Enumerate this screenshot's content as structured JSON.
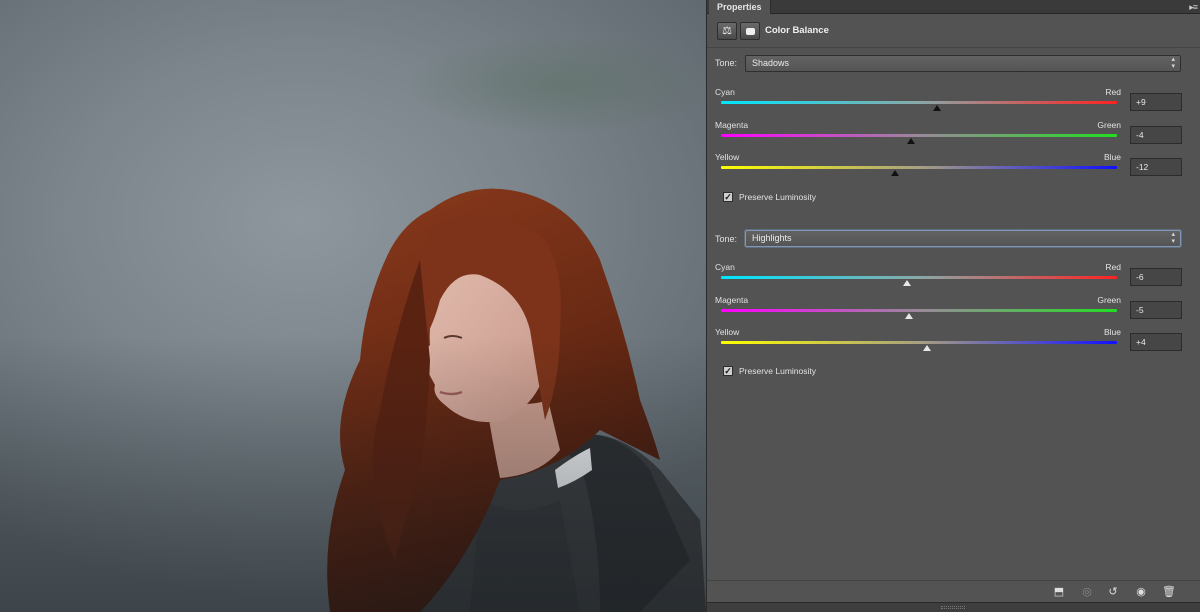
{
  "panel": {
    "tab_label": "Properties",
    "menu_icon": "panel-menu-icon",
    "adjustment_title": "Color Balance",
    "header_icons": [
      "color-balance-icon",
      "layer-mask-icon"
    ]
  },
  "shadows": {
    "tone_label": "Tone:",
    "tone_value": "Shadows",
    "sliders": [
      {
        "left": "Cyan",
        "right": "Red",
        "value": "+9",
        "level": 9
      },
      {
        "left": "Magenta",
        "right": "Green",
        "value": "-4",
        "level": -4
      },
      {
        "left": "Yellow",
        "right": "Blue",
        "value": "-12",
        "level": -12
      }
    ],
    "preserve_label": "Preserve Luminosity",
    "preserve_checked": true
  },
  "highlights": {
    "tone_label": "Tone:",
    "tone_value": "Highlights",
    "sliders": [
      {
        "left": "Cyan",
        "right": "Red",
        "value": "-6",
        "level": -6
      },
      {
        "left": "Magenta",
        "right": "Green",
        "value": "-5",
        "level": -5
      },
      {
        "left": "Yellow",
        "right": "Blue",
        "value": "+4",
        "level": 4
      }
    ],
    "preserve_label": "Preserve Luminosity",
    "preserve_checked": true
  },
  "footer_icons": [
    "clip-to-layer-icon",
    "view-previous-state-icon",
    "reset-icon",
    "visibility-eye-icon",
    "delete-icon"
  ],
  "colors": {
    "panel_bg": "#535353",
    "cyan": "#00e6ff",
    "red": "#ff2222",
    "magenta": "#ff00ff",
    "green": "#22dd22",
    "yellow": "#ffff00",
    "blue": "#1010ff"
  }
}
